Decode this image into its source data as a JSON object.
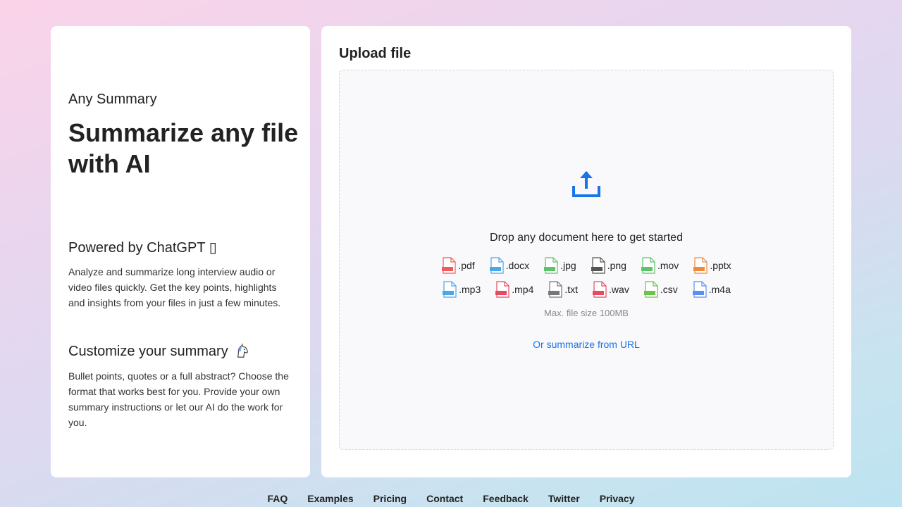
{
  "left": {
    "app_name": "Any Summary",
    "hero": "Summarize any file with AI",
    "section1": {
      "title": "Powered by ChatGPT",
      "title_suffix": "▯",
      "text": "Analyze and summarize long interview audio or video files quickly. Get the key points, highlights and insights from your files in just a few minutes."
    },
    "section2": {
      "title": "Customize your summary",
      "emoji_icon": "unicorn-emoji-icon",
      "text": "Bullet points, quotes or a full abstract? Choose the format that works best for you. Provide your own summary instructions or let our AI do the work for you."
    }
  },
  "upload": {
    "title": "Upload file",
    "icon": "upload-arrow-icon",
    "drop_text": "Drop any document here to get started",
    "formats_row1": [
      {
        "label": ".pdf",
        "color": "#f05a5a"
      },
      {
        "label": ".docx",
        "color": "#4aa8e8"
      },
      {
        "label": ".jpg",
        "color": "#5dc26a"
      },
      {
        "label": ".png",
        "color": "#555555"
      },
      {
        "label": ".mov",
        "color": "#5dc26a"
      },
      {
        "label": ".pptx",
        "color": "#f08a3a"
      }
    ],
    "formats_row2": [
      {
        "label": ".mp3",
        "color": "#4aa8e8"
      },
      {
        "label": ".mp4",
        "color": "#e84a5f"
      },
      {
        "label": ".txt",
        "color": "#777777"
      },
      {
        "label": ".wav",
        "color": "#e84a5f"
      },
      {
        "label": ".csv",
        "color": "#6cc24a"
      },
      {
        "label": ".m4a",
        "color": "#5b8ff0"
      }
    ],
    "max_size": "Max. file size 100MB",
    "url_link": "Or summarize from URL"
  },
  "footer": {
    "links": [
      "FAQ",
      "Examples",
      "Pricing",
      "Contact",
      "Feedback",
      "Twitter",
      "Privacy"
    ]
  },
  "colors": {
    "accent": "#1a73e8"
  }
}
